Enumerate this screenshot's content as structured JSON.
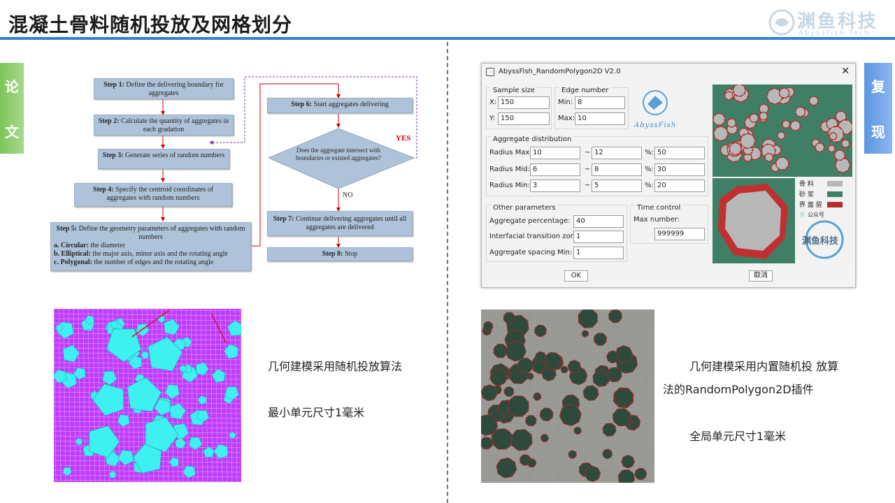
{
  "header": {
    "title": "混凝土骨料随机投放及网格划分",
    "logo_name": "渊鱼科技",
    "logo_sub": "AbyssFish Tech"
  },
  "side_tabs": {
    "left": [
      "论",
      "文"
    ],
    "right": [
      "复",
      "现"
    ]
  },
  "flowchart": {
    "step1": {
      "bold": "Step 1:",
      "text": " Define the delivering boundary for aggregates"
    },
    "step2": {
      "bold": "Step 2:",
      "text": " Calculate the quantity of aggregates in each gradation"
    },
    "step3": {
      "bold": "Step 3:",
      "text": " Generate series of random numbers"
    },
    "step4": {
      "bold": "Step 4:",
      "text": " Specify the centroid coordinates of aggregates with random numbers"
    },
    "step5": {
      "bold": "Step 5:",
      "text": " Define the geometry parameters of aggregates with random numbers",
      "a_bold": "a. Circular:",
      "a_text": " the diameter",
      "b_bold": "b. Elliptical:",
      "b_text": " the major axis, minor axis and the rotating angle",
      "c_bold": "c. Polygonal:",
      "c_text": " the number of edges and the rotating angle"
    },
    "step6": {
      "bold": "Step 6:",
      "text": " Start aggregates delivering"
    },
    "decision": "Does the aggregate intersect with boundaries or existed aggregates?",
    "yes": "YES",
    "no": "NO",
    "step7": {
      "bold": "Step 7:",
      "text": " Continue delivering aggregates until all aggregates are delivered"
    },
    "step8": {
      "bold": "Step 8:",
      "text": " Stop"
    }
  },
  "dialog": {
    "title": "AbyssFish_RandomPolygon2D V2.0",
    "close_icon": "close-icon",
    "sample_size": {
      "label": "Sample size",
      "x_label": "X:",
      "x_value": "150",
      "y_label": "Y:",
      "y_value": "150"
    },
    "edge_number": {
      "label": "Edge number",
      "min_label": "Min:",
      "min_value": "8",
      "max_label": "Max:",
      "max_value": "10"
    },
    "logo_text": "AbyssFish",
    "aggregate_distribution": {
      "label": "Aggregate distribution",
      "rows": [
        {
          "name": "Radius Max:",
          "from": "10",
          "to": "12",
          "pct_label": "%:",
          "pct": "50"
        },
        {
          "name": "Radius Mid:",
          "from": "6",
          "to": "8",
          "pct_label": "%:",
          "pct": "30"
        },
        {
          "name": "Radius Min:",
          "from": "3",
          "to": "5",
          "pct_label": "%:",
          "pct": "20"
        }
      ],
      "tilde": "~"
    },
    "other": {
      "label": "Other parameters",
      "agg_pct_label": "Aggregate percentage:",
      "agg_pct": "40",
      "itz_label": "Interfacial transition zone:",
      "itz": "1",
      "spacing_label": "Aggregate spacing Min:",
      "spacing": "1"
    },
    "time": {
      "label": "Time control",
      "max_label": "Max number:",
      "max_value": "999999"
    },
    "legend": {
      "aggregate": "骨  料",
      "mortar": "砂  浆",
      "itz": "界 面 层",
      "wechat": "公众号",
      "brand": "渊鱼科技"
    },
    "ok": "OK",
    "cancel": "取消"
  },
  "captions": {
    "left_1": "几何建模采用随机投放算法",
    "left_2": "最小单元尺寸1毫米",
    "right_1": "几何建模采用内置随机投 放算",
    "right_2": "法的RandomPolygon2D插件",
    "right_3": "全局单元尺寸1毫米"
  },
  "colors": {
    "accent": "#2f7fd8",
    "mesh_magenta": "#c03bff",
    "aggregate_cyan": "#3ff0f0",
    "mortar_green": "#3e7f66",
    "itz_red": "#b03030",
    "aggregate_gray": "#b8b8b8"
  }
}
